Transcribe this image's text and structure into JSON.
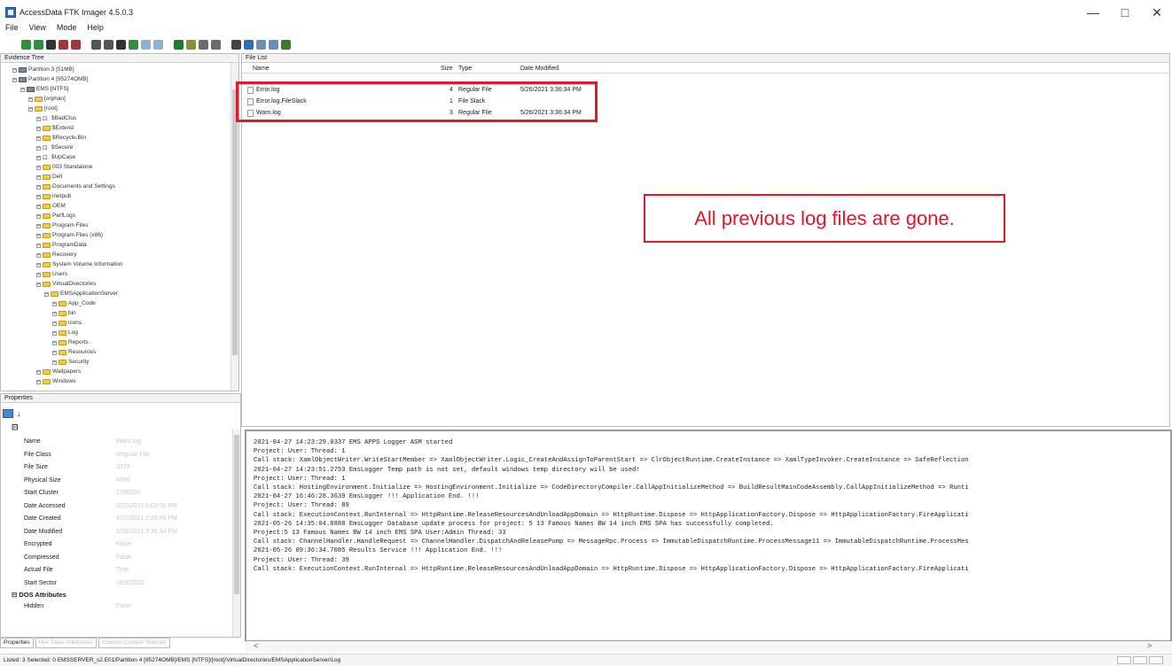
{
  "app": {
    "title": "AccessData FTK Imager 4.5.0.3",
    "window_controls": [
      "—",
      "□",
      "✕"
    ]
  },
  "menu": [
    "File",
    "View",
    "Mode",
    "Help"
  ],
  "toolbar_icons": [
    {
      "name": "add-evidence-icon",
      "color": "#2f8f3a"
    },
    {
      "name": "add-all-evidence-icon",
      "color": "#2f8f3a"
    },
    {
      "name": "image-mounting-icon",
      "color": "#333333"
    },
    {
      "name": "remove-evidence-icon",
      "color": "#a03a3a"
    },
    {
      "name": "remove-all-evidence-icon",
      "color": "#a03a3a"
    },
    {
      "name": "create-disk-image-icon",
      "color": "#555555"
    },
    {
      "name": "export-disk-image-icon",
      "color": "#555555"
    },
    {
      "name": "export-logical-image-icon",
      "color": "#333333"
    },
    {
      "name": "add-to-custom-content-icon",
      "color": "#2f8f3a"
    },
    {
      "name": "create-custom-content-icon",
      "color": "#8fb0d8"
    },
    {
      "name": "decrypt-icon",
      "color": "#8fb0d8"
    },
    {
      "name": "verify-drive-icon",
      "color": "#1e7a2e"
    },
    {
      "name": "capture-memory-icon",
      "color": "#8d8d3a"
    },
    {
      "name": "obtain-protected-files-icon",
      "color": "#6b6b6b"
    },
    {
      "name": "detect-efs-icon",
      "color": "#6b6b6b"
    },
    {
      "name": "export-files-icon",
      "color": "#444444"
    },
    {
      "name": "export-file-hash-icon",
      "color": "#2b6fbd"
    },
    {
      "name": "add-to-custom-content-2-icon",
      "color": "#6b8fb8"
    },
    {
      "name": "export-directory-listing-icon",
      "color": "#6b8fb8"
    },
    {
      "name": "help-icon",
      "color": "#3a7a2a"
    }
  ],
  "evidence_tree": {
    "title": "Evidence Tree",
    "rows": [
      {
        "label": "Partition 3 [51MB]",
        "indent": 1,
        "icon": "partition"
      },
      {
        "label": "Partition 4 [95274OMB]",
        "indent": 1,
        "icon": "partition"
      },
      {
        "label": "EMS [NTFS]",
        "indent": 2,
        "icon": "drive"
      },
      {
        "label": "[orphan]",
        "indent": 3,
        "icon": "folder"
      },
      {
        "label": "[root]",
        "indent": 3,
        "icon": "folder"
      },
      {
        "label": "$BadClus",
        "indent": 4,
        "icon": "special"
      },
      {
        "label": "$Extend",
        "indent": 4,
        "icon": "folder"
      },
      {
        "label": "$Recycle.Bin",
        "indent": 4,
        "icon": "folder"
      },
      {
        "label": "$Secure",
        "indent": 4,
        "icon": "special"
      },
      {
        "label": "$UpCase",
        "indent": 4,
        "icon": "special"
      },
      {
        "label": "003 Standalone",
        "indent": 4,
        "icon": "folder"
      },
      {
        "label": "Dell",
        "indent": 4,
        "icon": "folder"
      },
      {
        "label": "Documents and Settings",
        "indent": 4,
        "icon": "folder"
      },
      {
        "label": "inetpub",
        "indent": 4,
        "icon": "folder"
      },
      {
        "label": "OEM",
        "indent": 4,
        "icon": "folder"
      },
      {
        "label": "PerfLogs",
        "indent": 4,
        "icon": "folder"
      },
      {
        "label": "Program Files",
        "indent": 4,
        "icon": "folder"
      },
      {
        "label": "Program Files (x86)",
        "indent": 4,
        "icon": "folder"
      },
      {
        "label": "ProgramData",
        "indent": 4,
        "icon": "folder"
      },
      {
        "label": "Recovery",
        "indent": 4,
        "icon": "folder"
      },
      {
        "label": "System Volume Information",
        "indent": 4,
        "icon": "folder"
      },
      {
        "label": "Users",
        "indent": 4,
        "icon": "folder"
      },
      {
        "label": "VirtualDirectories",
        "indent": 4,
        "icon": "folder"
      },
      {
        "label": "EMSApplicationServer",
        "indent": 5,
        "icon": "folder"
      },
      {
        "label": "App_Code",
        "indent": 6,
        "icon": "folder"
      },
      {
        "label": "bin",
        "indent": 6,
        "icon": "folder"
      },
      {
        "label": "icons",
        "indent": 6,
        "icon": "folder"
      },
      {
        "label": "Log",
        "indent": 6,
        "icon": "folder"
      },
      {
        "label": "Reports",
        "indent": 6,
        "icon": "folder"
      },
      {
        "label": "Resources",
        "indent": 6,
        "icon": "folder"
      },
      {
        "label": "Security",
        "indent": 6,
        "icon": "folder"
      },
      {
        "label": "Wallpapers",
        "indent": 4,
        "icon": "folder"
      },
      {
        "label": "Windows",
        "indent": 4,
        "icon": "folder"
      }
    ]
  },
  "properties": {
    "title": "Properties",
    "category_top": "",
    "rows": [
      {
        "label": "Name",
        "value": "Warn.log"
      },
      {
        "label": "File Class",
        "value": "Regular File"
      },
      {
        "label": "File Size",
        "value": "3374"
      },
      {
        "label": "Physical Size",
        "value": "4096"
      },
      {
        "label": "Start Cluster",
        "value": "2295250"
      },
      {
        "label": "Date Accessed",
        "value": "5/27/2021 6:03:00 PM"
      },
      {
        "label": "Date Created",
        "value": "4/27/2021 2:26:45 PM"
      },
      {
        "label": "Date Modified",
        "value": "5/26/2021 3:36:34 PM"
      },
      {
        "label": "Encrypted",
        "value": "False"
      },
      {
        "label": "Compressed",
        "value": "False"
      },
      {
        "label": "Actual File",
        "value": "True"
      },
      {
        "label": "Start Sector",
        "value": "18362520"
      }
    ],
    "category_dos": "DOS Attributes",
    "hidden_label": "Hidden",
    "hidden_value": "False",
    "tabs": [
      "Properties",
      "Hex Value Interpreter",
      "Custom Content Sources"
    ]
  },
  "file_list": {
    "title": "File List",
    "columns": {
      "name": "Name",
      "size": "Size",
      "type": "Type",
      "date": "Date Modified"
    },
    "rows": [
      {
        "name": "Error.log",
        "size": "4",
        "type": "Regular File",
        "date": "5/26/2021 3:36:34 PM"
      },
      {
        "name": "Error.log.FileSlack",
        "size": "1",
        "type": "File Slack",
        "date": ""
      },
      {
        "name": "Warn.log",
        "size": "3",
        "type": "Regular File",
        "date": "5/26/2021 3:36:34 PM"
      }
    ]
  },
  "annotation": {
    "callout_text": "All previous log files are gone.",
    "color": "#e0182b"
  },
  "log_lines": [
    "2021-04-27 14:23:29.0337 EMS APPS Logger ASM started",
    "  Project: User: Thread: 1",
    "  Call stack: XamlObjectWriter.WriteStartMember => XamlObjectWriter.Logic_CreateAndAssignToParentStart => ClrObjectRuntime.CreateInstance => XamlTypeInvoker.CreateInstance => SafeReflection",
    "2021-04-27 14:23:51.2753 EmsLogger Temp path is not set, default windows temp directory will be used!",
    "  Project: User: Thread: 1",
    "  Call stack: HostingEnvironment.Initialize => HostingEnvironment.Initialize => CodeDirectoryCompiler.CallAppInitializeMethod => BuildResultMainCodeAssembly.CallAppInitializeMethod => Runti",
    "2021-04-27 16:46:28.3639 EmsLogger !!! Application End. !!!",
    "  Project: User: Thread: 89",
    "  Call stack: ExecutionContext.RunInternal => HttpRuntime.ReleaseResourcesAndUnloadAppDomain => HttpRuntime.Dispose => HttpApplicationFactory.Dispose => HttpApplicationFactory.FireApplicati",
    "2021-05-26 14:35:04.8888 EmsLogger Database update process for project: 5 13 Famous Names BW 14 inch EMS SPA has successfully completed.",
    "  Project:5 13 Famous Names BW 14 inch EMS SPA User:Admin Thread: 33",
    "  Call stack: ChannelHandler.HandleRequest => ChannelHandler.DispatchAndReleasePump => MessageRpc.Process => ImmutableDispatchRuntime.ProcessMessage11 => ImmutableDispatchRuntime.ProcessMes",
    "2021-05-26 09:36:34.7085 Results Service !!! Application End. !!!",
    "  Project: User: Thread: 39",
    "  Call stack: ExecutionContext.RunInternal => HttpRuntime.ReleaseResourcesAndUnloadAppDomain => HttpRuntime.Dispose => HttpApplicationFactory.Dispose => HttpApplicationFactory.FireApplicati"
  ],
  "statusbar": {
    "text": "Listed: 3  Selected: 0  EMSSERVER_s2.E01/Partition 4 [95274OMB]/EMS [NTFS]/[root]/VirtualDirectories/EMSApplicationServer/Log"
  },
  "scroll": {
    "left_arrow": "<",
    "right_arrow": ">"
  }
}
